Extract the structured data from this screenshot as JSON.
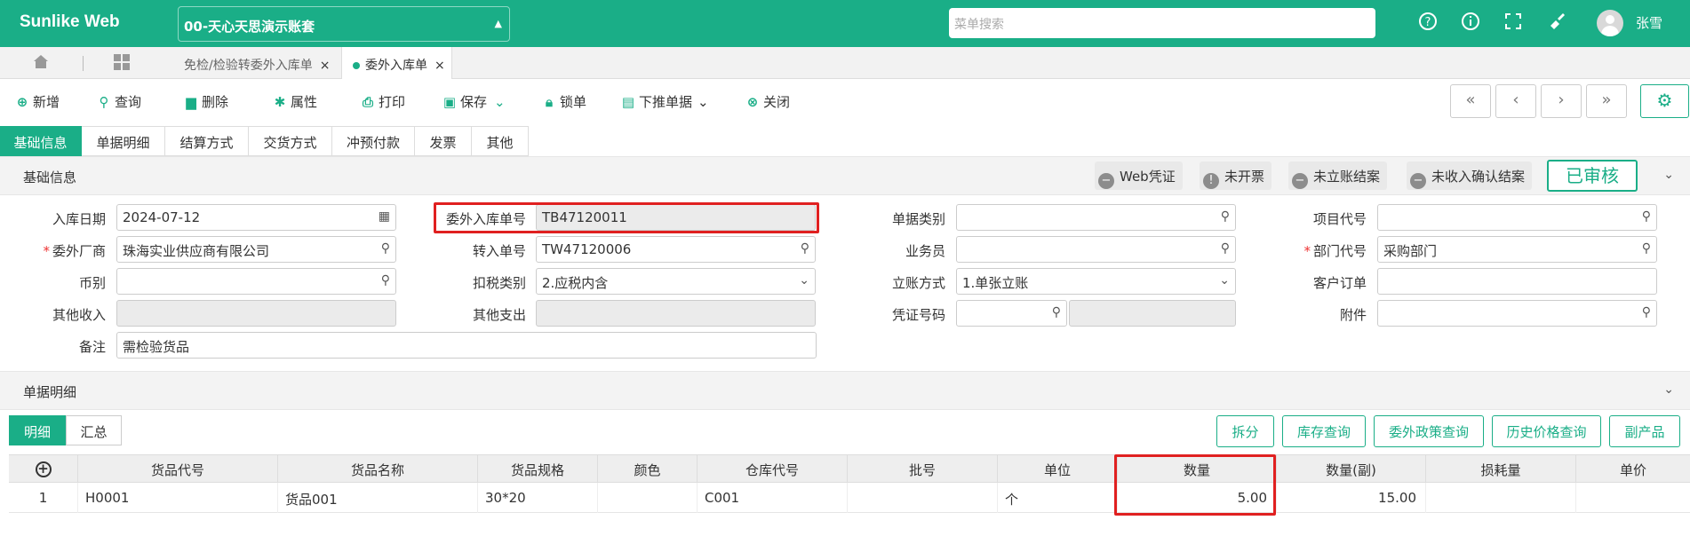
{
  "app": {
    "brand": "Sunlike Web",
    "account": "00-天心天思演示账套",
    "search_placeholder": "菜单搜索",
    "user": "张雪"
  },
  "icons": {
    "help": "help-circle-icon",
    "info": "info-icon",
    "fullscreen": "fullscreen-icon",
    "theme": "brush-icon"
  },
  "page_tabs": [
    {
      "label": "免检/检验转委外入库单"
    },
    {
      "label": "委外入库单"
    }
  ],
  "toolbar": {
    "add": "新增",
    "query": "查询",
    "delete": "删除",
    "props": "属性",
    "print": "打印",
    "save": "保存",
    "lock": "锁单",
    "push": "下推单据",
    "close": "关闭"
  },
  "section_tabs": [
    "基础信息",
    "单据明细",
    "结算方式",
    "交货方式",
    "冲预付款",
    "发票",
    "其他"
  ],
  "basic_section": {
    "title": "基础信息",
    "chips": [
      "Web凭证",
      "未开票",
      "未立账结案",
      "未收入确认结案"
    ],
    "status": "已审核"
  },
  "fields": {
    "in_date": {
      "label": "入库日期",
      "value": "2024-07-12"
    },
    "vendor": {
      "label": "委外厂商",
      "value": "珠海实业供应商有限公司"
    },
    "currency": {
      "label": "币别",
      "value": ""
    },
    "other_income": {
      "label": "其他收入",
      "value": ""
    },
    "remark": {
      "label": "备注",
      "value": "需检验货品"
    },
    "order_no": {
      "label": "委外入库单号",
      "value": "TB47120011"
    },
    "transfer_no": {
      "label": "转入单号",
      "value": "TW47120006"
    },
    "tax_type": {
      "label": "扣税类别",
      "value": "2.应税内含"
    },
    "other_expense": {
      "label": "其他支出",
      "value": ""
    },
    "doc_type": {
      "label": "单据类别",
      "value": ""
    },
    "salesman": {
      "label": "业务员",
      "value": ""
    },
    "account_mode": {
      "label": "立账方式",
      "value": "1.单张立账"
    },
    "voucher_no": {
      "label": "凭证号码",
      "value": ""
    },
    "project_code": {
      "label": "项目代号",
      "value": ""
    },
    "dept_code": {
      "label": "部门代号",
      "value": "采购部门"
    },
    "customer_order": {
      "label": "客户订单",
      "value": ""
    },
    "attachment": {
      "label": "附件",
      "value": ""
    }
  },
  "detail_section": {
    "title": "单据明细",
    "subtabs": [
      "明细",
      "汇总"
    ],
    "buttons": [
      "拆分",
      "库存查询",
      "委外政策查询",
      "历史价格查询",
      "副产品"
    ]
  },
  "grid": {
    "columns": [
      "货品代号",
      "货品名称",
      "货品规格",
      "颜色",
      "仓库代号",
      "批号",
      "单位",
      "数量",
      "数量(副)",
      "损耗量",
      "单价"
    ],
    "rows": [
      {
        "idx": "1",
        "code": "H0001",
        "name": "货品001",
        "spec": "30*20",
        "color": "",
        "warehouse": "C001",
        "batch": "",
        "unit": "个",
        "qty": "5.00",
        "qty2": "15.00",
        "loss": "",
        "price": ""
      }
    ]
  }
}
